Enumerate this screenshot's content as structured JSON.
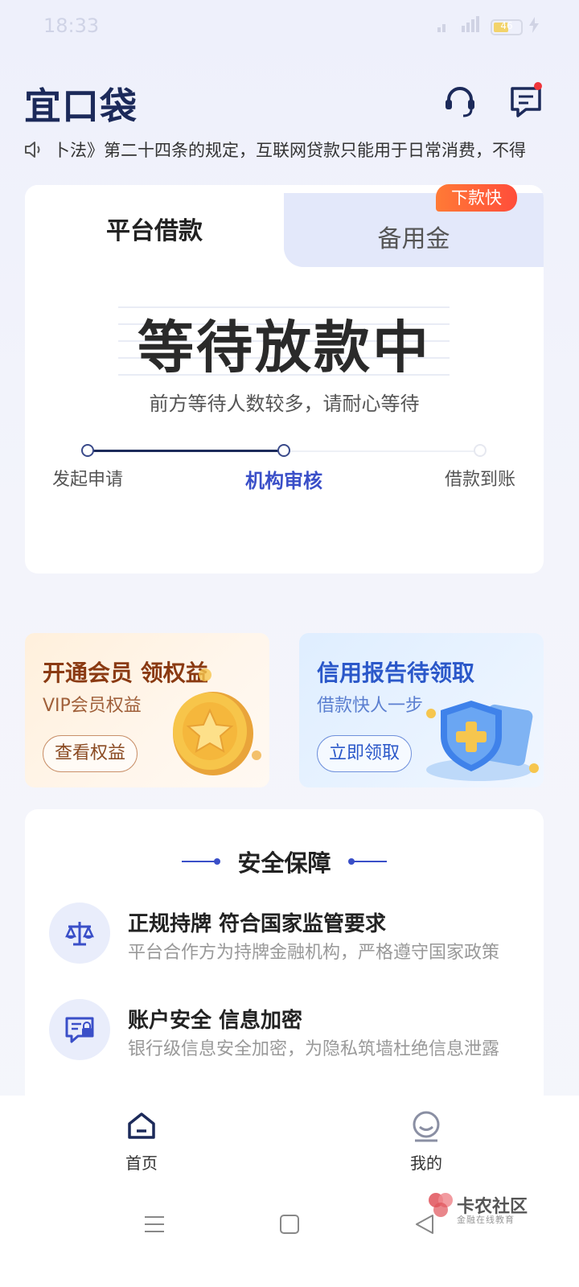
{
  "status_bar": {
    "time": "18:33",
    "battery": "46"
  },
  "header": {
    "app_name": "宜口袋"
  },
  "notice": {
    "text": "卜法》第二十四条的规定，互联网贷款只能用于日常消费，不得"
  },
  "tabs": {
    "active": "平台借款",
    "inactive": "备用金",
    "badge": "下款快"
  },
  "loan_status": {
    "title": "等待放款中",
    "subtitle": "前方等待人数较多，请耐心等待"
  },
  "progress": {
    "steps": [
      "发起申请",
      "机构审核",
      "借款到账"
    ],
    "current_index": 1
  },
  "promos": {
    "vip": {
      "title": "开通会员 领权益",
      "subtitle": "VIP会员权益",
      "button": "查看权益"
    },
    "credit": {
      "title": "信用报告待领取",
      "subtitle": "借款快人一步",
      "button": "立即领取"
    }
  },
  "safety": {
    "title": "安全保障",
    "items": [
      {
        "title": "正规持牌 符合国家监管要求",
        "desc": "平台合作方为持牌金融机构，严格遵守国家政策",
        "icon": "scale-icon"
      },
      {
        "title": "账户安全 信息加密",
        "desc": "银行级信息安全加密，为隐私筑墙杜绝信息泄露",
        "icon": "secure-card-icon"
      }
    ]
  },
  "tabbar": {
    "home": "首页",
    "mine": "我的"
  },
  "watermark": {
    "title": "卡农社区",
    "subtitle": "金融在线教育"
  },
  "colors": {
    "accent": "#3a4fc8",
    "badge": "#ff5a38",
    "dark": "#1c2a5a"
  }
}
